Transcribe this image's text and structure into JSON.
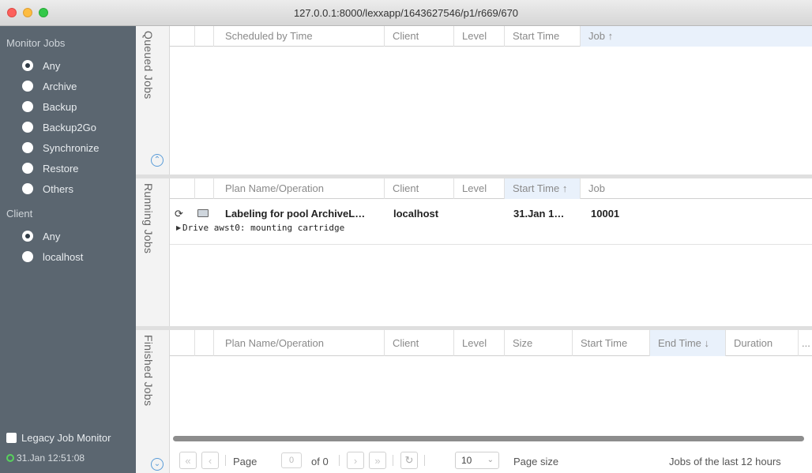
{
  "window": {
    "title": "127.0.0.1:8000/lexxapp/1643627546/p1/r669/670"
  },
  "sidebar": {
    "monitor_jobs_title": "Monitor Jobs",
    "job_types": [
      {
        "label": "Any",
        "selected": true
      },
      {
        "label": "Archive",
        "selected": false
      },
      {
        "label": "Backup",
        "selected": false
      },
      {
        "label": "Backup2Go",
        "selected": false
      },
      {
        "label": "Synchronize",
        "selected": false
      },
      {
        "label": "Restore",
        "selected": false
      },
      {
        "label": "Others",
        "selected": false
      }
    ],
    "client_title": "Client",
    "clients": [
      {
        "label": "Any",
        "selected": true
      },
      {
        "label": "localhost",
        "selected": false
      }
    ],
    "legacy_label": "Legacy Job Monitor",
    "timestamp": "31.Jan 12:51:08"
  },
  "queued": {
    "tab_label": "Queued Jobs",
    "columns": [
      "Scheduled by Time",
      "Client",
      "Level",
      "Start Time",
      "Job ↑"
    ]
  },
  "running": {
    "tab_label": "Running Jobs",
    "columns": [
      "Plan Name/Operation",
      "Client",
      "Level",
      "Start Time ↑",
      "Job"
    ],
    "rows": [
      {
        "name": "Labeling for pool ArchiveL…",
        "client": "localhost",
        "level": "",
        "start_time": "31.Jan 1…",
        "job": "10001",
        "detail": "Drive awst0: mounting cartridge"
      }
    ]
  },
  "finished": {
    "tab_label": "Finished Jobs",
    "columns": [
      "Plan Name/Operation",
      "Client",
      "Level",
      "Size",
      "Start Time",
      "End Time ↓",
      "Duration",
      "..."
    ]
  },
  "footer": {
    "page_label": "Page",
    "page_value": "0",
    "of_label": "of 0",
    "page_size_value": "10",
    "page_size_label": "Page size",
    "range_label": "Jobs of the last 12 hours"
  },
  "colors": {
    "sidebar_bg": "#5b6670",
    "accent": "#5a9cd8",
    "sorted_header_bg": "#e9f1fb",
    "status_ok": "#57d35c"
  }
}
